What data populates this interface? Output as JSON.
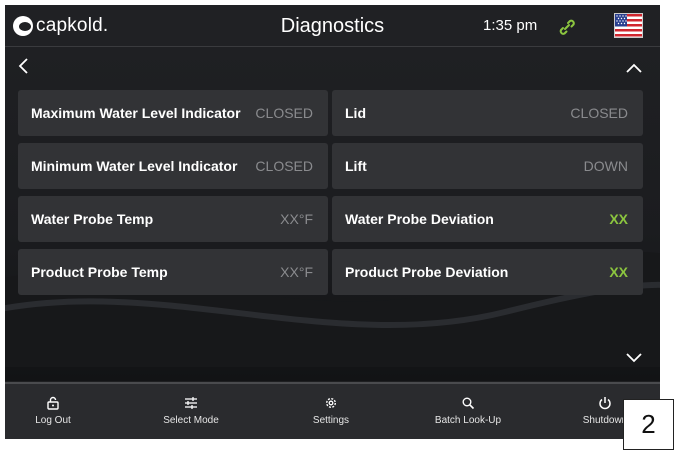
{
  "app": {
    "brand": "capkold.",
    "title": "Diagnostics",
    "time": "1:35 pm"
  },
  "diagnostics": [
    {
      "label": "Maximum Water Level Indicator",
      "value": "CLOSED",
      "status": "neutral"
    },
    {
      "label": "Lid",
      "value": "CLOSED",
      "status": "neutral"
    },
    {
      "label": "Minimum Water Level Indicator",
      "value": "CLOSED",
      "status": "neutral"
    },
    {
      "label": "Lift",
      "value": "DOWN",
      "status": "neutral"
    },
    {
      "label": "Water Probe Temp",
      "value": "XX°F",
      "status": "neutral"
    },
    {
      "label": "Water Probe Deviation",
      "value": "XX",
      "status": "ok"
    },
    {
      "label": "Product Probe Temp",
      "value": "XX°F",
      "status": "neutral"
    },
    {
      "label": "Product Probe Deviation",
      "value": "XX",
      "status": "ok"
    }
  ],
  "nav": [
    {
      "label": "Log Out",
      "icon": "lock-icon"
    },
    {
      "label": "Select Mode",
      "icon": "sliders-icon"
    },
    {
      "label": "Settings",
      "icon": "gear-icon"
    },
    {
      "label": "Batch Look-Up",
      "icon": "search-icon"
    },
    {
      "label": "Shutdown",
      "icon": "power-icon"
    }
  ],
  "annotation": {
    "number": "2"
  },
  "colors": {
    "ok": "#8cc63f",
    "neutral": "#8a8b8e",
    "card": "#323336",
    "background": "#1e1f21"
  }
}
